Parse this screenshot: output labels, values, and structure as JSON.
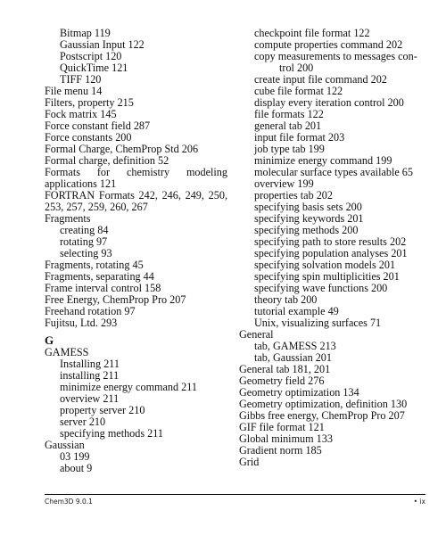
{
  "left_column": {
    "entries": [
      {
        "level": 1,
        "text": "Bitmap 119"
      },
      {
        "level": 1,
        "text": "Gaussian Input 122"
      },
      {
        "level": 1,
        "text": "Postscript 120"
      },
      {
        "level": 1,
        "text": "QuickTime 121"
      },
      {
        "level": 1,
        "text": "TIFF 120"
      },
      {
        "level": 0,
        "text": "File menu 14"
      },
      {
        "level": 0,
        "text": "Filters, property 215"
      },
      {
        "level": 0,
        "text": "Fock matrix 145"
      },
      {
        "level": 0,
        "text": "Force constant field 287"
      },
      {
        "level": 0,
        "text": "Force constants 200"
      },
      {
        "level": 0,
        "text": "Formal Charge, ChemProp Std 206"
      },
      {
        "level": 0,
        "text": "Formal charge, definition 52"
      },
      {
        "level": 0,
        "text": "Formats for chemistry modeling applications 121",
        "wrap": true
      },
      {
        "level": 0,
        "text": "FORTRAN Formats 242, 246, 249, 250, 253, 257, 259, 260, 267",
        "wrap": true
      },
      {
        "level": 0,
        "text": "Fragments"
      },
      {
        "level": 1,
        "text": "creating 84"
      },
      {
        "level": 1,
        "text": "rotating 97"
      },
      {
        "level": 1,
        "text": "selecting 93"
      },
      {
        "level": 0,
        "text": "Fragments, rotating 45"
      },
      {
        "level": 0,
        "text": "Fragments, separating 44"
      },
      {
        "level": 0,
        "text": "Frame interval control 158"
      },
      {
        "level": 0,
        "text": "Free Energy, ChemProp Pro 207"
      },
      {
        "level": 0,
        "text": "Freehand rotation 97"
      },
      {
        "level": 0,
        "text": "Fujitsu, Ltd. 293"
      },
      {
        "level": "letter",
        "text": "G"
      },
      {
        "level": 0,
        "text": "GAMESS"
      },
      {
        "level": 1,
        "text": "Installing 211"
      },
      {
        "level": 1,
        "text": "installing 211"
      },
      {
        "level": 1,
        "text": "minimize energy command 211"
      },
      {
        "level": 1,
        "text": "overview 211"
      },
      {
        "level": 1,
        "text": "property server 210"
      },
      {
        "level": 1,
        "text": "server 210"
      },
      {
        "level": 1,
        "text": "specifying methods 211"
      },
      {
        "level": 0,
        "text": "Gaussian"
      },
      {
        "level": 1,
        "text": "03 199"
      },
      {
        "level": 1,
        "text": "about 9"
      }
    ]
  },
  "right_column": {
    "entries": [
      {
        "level": 1,
        "text": "checkpoint file format 122"
      },
      {
        "level": 1,
        "text": "compute properties command 202"
      },
      {
        "level": 1,
        "text": "copy measurements to messages con-",
        "justify": true
      },
      {
        "level": 2,
        "text": "trol 200"
      },
      {
        "level": 1,
        "text": "create input file command 202"
      },
      {
        "level": 1,
        "text": "cube file format 122"
      },
      {
        "level": 1,
        "text": "display every iteration control 200"
      },
      {
        "level": 1,
        "text": "file formats 122"
      },
      {
        "level": 1,
        "text": "general tab 201"
      },
      {
        "level": 1,
        "text": "input file format 203"
      },
      {
        "level": 1,
        "text": "job type tab 199"
      },
      {
        "level": 1,
        "text": "minimize energy command 199"
      },
      {
        "level": 1,
        "text": "molecular surface types available 65"
      },
      {
        "level": 1,
        "text": "overview 199"
      },
      {
        "level": 1,
        "text": "properties tab 202"
      },
      {
        "level": 1,
        "text": "specifying basis sets 200"
      },
      {
        "level": 1,
        "text": "specifying keywords 201"
      },
      {
        "level": 1,
        "text": "specifying methods 200"
      },
      {
        "level": 1,
        "text": "specifying path to store results 202"
      },
      {
        "level": 1,
        "text": "specifying population analyses 201"
      },
      {
        "level": 1,
        "text": "specifying solvation models 201"
      },
      {
        "level": 1,
        "text": "specifying spin multiplicities 201"
      },
      {
        "level": 1,
        "text": "specifying wave functions 200"
      },
      {
        "level": 1,
        "text": "theory tab 200"
      },
      {
        "level": 1,
        "text": "tutorial example 49"
      },
      {
        "level": 1,
        "text": "Unix, visualizing surfaces 71"
      },
      {
        "level": 0,
        "text": "General"
      },
      {
        "level": 1,
        "text": "tab, GAMESS 213"
      },
      {
        "level": 1,
        "text": "tab, Gaussian 201"
      },
      {
        "level": 0,
        "text": "General tab 181, 201"
      },
      {
        "level": 0,
        "text": "Geometry field 276"
      },
      {
        "level": 0,
        "text": "Geometry optimization 134"
      },
      {
        "level": 0,
        "text": "Geometry optimization, definition 130"
      },
      {
        "level": 0,
        "text": "Gibbs free energy, ChemProp Pro 207"
      },
      {
        "level": 0,
        "text": "GIF file format 121"
      },
      {
        "level": 0,
        "text": "Global minimum 133"
      },
      {
        "level": 0,
        "text": "Gradient norm 185"
      },
      {
        "level": 0,
        "text": "Grid"
      }
    ]
  },
  "footer": {
    "product": "Chem3D 9.0.1",
    "page": "• ix"
  }
}
